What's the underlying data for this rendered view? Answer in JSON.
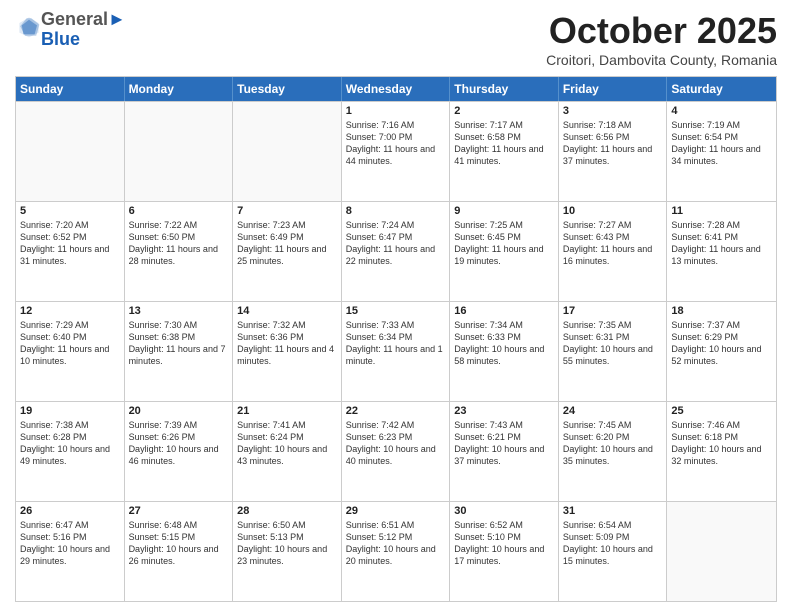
{
  "header": {
    "logo_general": "General",
    "logo_blue": "Blue",
    "month": "October 2025",
    "location": "Croitori, Dambovita County, Romania"
  },
  "days_of_week": [
    "Sunday",
    "Monday",
    "Tuesday",
    "Wednesday",
    "Thursday",
    "Friday",
    "Saturday"
  ],
  "weeks": [
    [
      {
        "day": "",
        "info": ""
      },
      {
        "day": "",
        "info": ""
      },
      {
        "day": "",
        "info": ""
      },
      {
        "day": "1",
        "info": "Sunrise: 7:16 AM\nSunset: 7:00 PM\nDaylight: 11 hours and 44 minutes."
      },
      {
        "day": "2",
        "info": "Sunrise: 7:17 AM\nSunset: 6:58 PM\nDaylight: 11 hours and 41 minutes."
      },
      {
        "day": "3",
        "info": "Sunrise: 7:18 AM\nSunset: 6:56 PM\nDaylight: 11 hours and 37 minutes."
      },
      {
        "day": "4",
        "info": "Sunrise: 7:19 AM\nSunset: 6:54 PM\nDaylight: 11 hours and 34 minutes."
      }
    ],
    [
      {
        "day": "5",
        "info": "Sunrise: 7:20 AM\nSunset: 6:52 PM\nDaylight: 11 hours and 31 minutes."
      },
      {
        "day": "6",
        "info": "Sunrise: 7:22 AM\nSunset: 6:50 PM\nDaylight: 11 hours and 28 minutes."
      },
      {
        "day": "7",
        "info": "Sunrise: 7:23 AM\nSunset: 6:49 PM\nDaylight: 11 hours and 25 minutes."
      },
      {
        "day": "8",
        "info": "Sunrise: 7:24 AM\nSunset: 6:47 PM\nDaylight: 11 hours and 22 minutes."
      },
      {
        "day": "9",
        "info": "Sunrise: 7:25 AM\nSunset: 6:45 PM\nDaylight: 11 hours and 19 minutes."
      },
      {
        "day": "10",
        "info": "Sunrise: 7:27 AM\nSunset: 6:43 PM\nDaylight: 11 hours and 16 minutes."
      },
      {
        "day": "11",
        "info": "Sunrise: 7:28 AM\nSunset: 6:41 PM\nDaylight: 11 hours and 13 minutes."
      }
    ],
    [
      {
        "day": "12",
        "info": "Sunrise: 7:29 AM\nSunset: 6:40 PM\nDaylight: 11 hours and 10 minutes."
      },
      {
        "day": "13",
        "info": "Sunrise: 7:30 AM\nSunset: 6:38 PM\nDaylight: 11 hours and 7 minutes."
      },
      {
        "day": "14",
        "info": "Sunrise: 7:32 AM\nSunset: 6:36 PM\nDaylight: 11 hours and 4 minutes."
      },
      {
        "day": "15",
        "info": "Sunrise: 7:33 AM\nSunset: 6:34 PM\nDaylight: 11 hours and 1 minute."
      },
      {
        "day": "16",
        "info": "Sunrise: 7:34 AM\nSunset: 6:33 PM\nDaylight: 10 hours and 58 minutes."
      },
      {
        "day": "17",
        "info": "Sunrise: 7:35 AM\nSunset: 6:31 PM\nDaylight: 10 hours and 55 minutes."
      },
      {
        "day": "18",
        "info": "Sunrise: 7:37 AM\nSunset: 6:29 PM\nDaylight: 10 hours and 52 minutes."
      }
    ],
    [
      {
        "day": "19",
        "info": "Sunrise: 7:38 AM\nSunset: 6:28 PM\nDaylight: 10 hours and 49 minutes."
      },
      {
        "day": "20",
        "info": "Sunrise: 7:39 AM\nSunset: 6:26 PM\nDaylight: 10 hours and 46 minutes."
      },
      {
        "day": "21",
        "info": "Sunrise: 7:41 AM\nSunset: 6:24 PM\nDaylight: 10 hours and 43 minutes."
      },
      {
        "day": "22",
        "info": "Sunrise: 7:42 AM\nSunset: 6:23 PM\nDaylight: 10 hours and 40 minutes."
      },
      {
        "day": "23",
        "info": "Sunrise: 7:43 AM\nSunset: 6:21 PM\nDaylight: 10 hours and 37 minutes."
      },
      {
        "day": "24",
        "info": "Sunrise: 7:45 AM\nSunset: 6:20 PM\nDaylight: 10 hours and 35 minutes."
      },
      {
        "day": "25",
        "info": "Sunrise: 7:46 AM\nSunset: 6:18 PM\nDaylight: 10 hours and 32 minutes."
      }
    ],
    [
      {
        "day": "26",
        "info": "Sunrise: 6:47 AM\nSunset: 5:16 PM\nDaylight: 10 hours and 29 minutes."
      },
      {
        "day": "27",
        "info": "Sunrise: 6:48 AM\nSunset: 5:15 PM\nDaylight: 10 hours and 26 minutes."
      },
      {
        "day": "28",
        "info": "Sunrise: 6:50 AM\nSunset: 5:13 PM\nDaylight: 10 hours and 23 minutes."
      },
      {
        "day": "29",
        "info": "Sunrise: 6:51 AM\nSunset: 5:12 PM\nDaylight: 10 hours and 20 minutes."
      },
      {
        "day": "30",
        "info": "Sunrise: 6:52 AM\nSunset: 5:10 PM\nDaylight: 10 hours and 17 minutes."
      },
      {
        "day": "31",
        "info": "Sunrise: 6:54 AM\nSunset: 5:09 PM\nDaylight: 10 hours and 15 minutes."
      },
      {
        "day": "",
        "info": ""
      }
    ]
  ]
}
